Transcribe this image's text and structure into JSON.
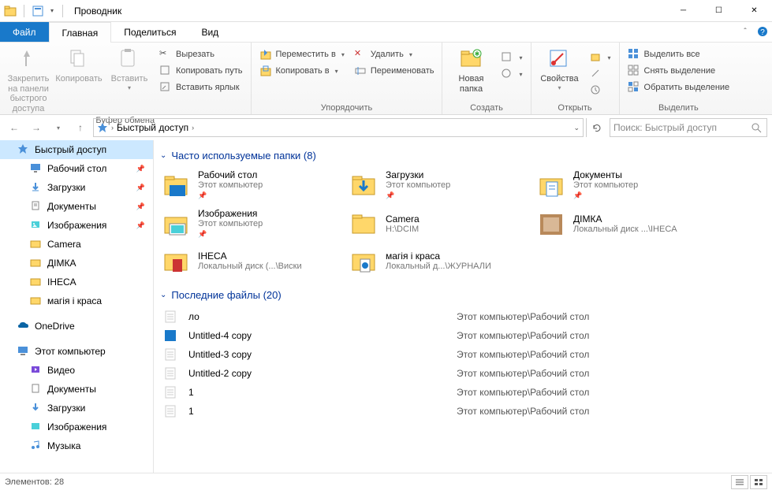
{
  "window": {
    "title": "Проводник"
  },
  "tabs": {
    "file": "Файл",
    "home": "Главная",
    "share": "Поделиться",
    "view": "Вид"
  },
  "ribbon": {
    "pin": "Закрепить на панели\nбыстрого доступа",
    "copy": "Копировать",
    "paste": "Вставить",
    "cut": "Вырезать",
    "copypath": "Копировать путь",
    "pasteshortcut": "Вставить ярлык",
    "clipboard": "Буфер обмена",
    "moveto": "Переместить в",
    "copyto": "Копировать в",
    "delete": "Удалить",
    "rename": "Переименовать",
    "organize": "Упорядочить",
    "newfolder": "Новая\nпапка",
    "newgroup": "Создать",
    "properties": "Свойства",
    "opengroup": "Открыть",
    "selectall": "Выделить все",
    "selectnone": "Снять выделение",
    "invertsel": "Обратить выделение",
    "selectgroup": "Выделить"
  },
  "breadcrumb": {
    "root": "Быстрый доступ"
  },
  "search": {
    "placeholder": "Поиск: Быстрый доступ"
  },
  "nav": {
    "quickaccess": "Быстрый доступ",
    "desktop": "Рабочий стол",
    "downloads": "Загрузки",
    "documents": "Документы",
    "pictures": "Изображения",
    "camera": "Camera",
    "dimka": "ДІМКА",
    "iheca": "IHECA",
    "magia": "магія і краса",
    "onedrive": "OneDrive",
    "thispc": "Этот компьютер",
    "videos": "Видео",
    "documents2": "Документы",
    "downloads2": "Загрузки",
    "pictures2": "Изображения",
    "music": "Музыка"
  },
  "sections": {
    "freq": "Часто используемые папки (8)",
    "recent": "Последние файлы (20)"
  },
  "folders": [
    {
      "name": "Рабочий стол",
      "loc": "Этот компьютер",
      "pin": true,
      "icon": "desktop"
    },
    {
      "name": "Загрузки",
      "loc": "Этот компьютер",
      "pin": true,
      "icon": "downloads"
    },
    {
      "name": "Документы",
      "loc": "Этот компьютер",
      "pin": true,
      "icon": "documents"
    },
    {
      "name": "Изображения",
      "loc": "Этот компьютер",
      "pin": true,
      "icon": "pictures"
    },
    {
      "name": "Camera",
      "loc": "H:\\DCIM",
      "pin": false,
      "icon": "folder"
    },
    {
      "name": "ДІМКА",
      "loc": "Локальный диск ...\\IHECA",
      "pin": false,
      "icon": "thumb"
    },
    {
      "name": "IHECA",
      "loc": "Локальный диск (...\\Виски",
      "pin": false,
      "icon": "folder-red"
    },
    {
      "name": "магія і краса",
      "loc": "Локальный д...\\ЖУРНАЛИ",
      "pin": false,
      "icon": "folder-edge"
    }
  ],
  "recent": [
    {
      "name": "ло",
      "loc": "Этот компьютер\\Рабочий стол",
      "icon": "doc"
    },
    {
      "name": "Untitled-4 copy",
      "loc": "Этот компьютер\\Рабочий стол",
      "icon": "blue"
    },
    {
      "name": "Untitled-3 copy",
      "loc": "Этот компьютер\\Рабочий стол",
      "icon": "doc"
    },
    {
      "name": "Untitled-2 copy",
      "loc": "Этот компьютер\\Рабочий стол",
      "icon": "doc"
    },
    {
      "name": "1",
      "loc": "Этот компьютер\\Рабочий стол",
      "icon": "doc"
    },
    {
      "name": "1",
      "loc": "Этот компьютер\\Рабочий стол",
      "icon": "doc"
    }
  ],
  "status": {
    "count": "Элементов: 28"
  }
}
